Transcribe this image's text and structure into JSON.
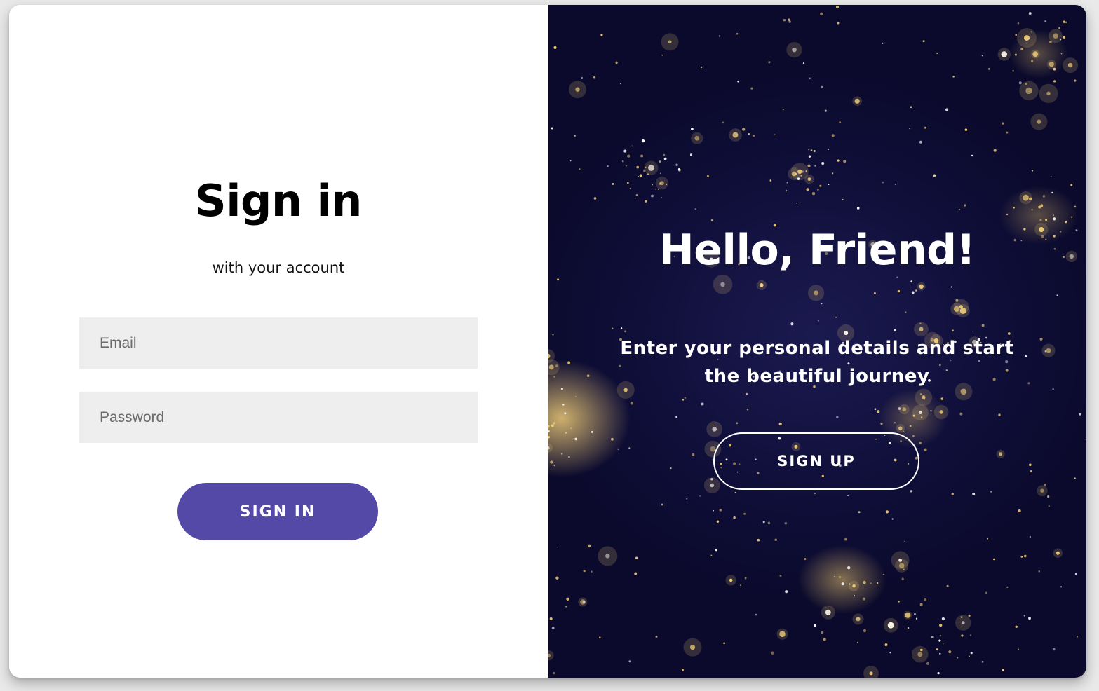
{
  "sign_in_panel": {
    "title": "Sign in",
    "subtitle": "with your account",
    "email_placeholder": "Email",
    "password_placeholder": "Password",
    "submit_label": "SIGN IN"
  },
  "sign_up_panel": {
    "heading": "Hello, Friend!",
    "tagline": "Enter your personal details and start the beautiful journey",
    "button_label": "SIGN UP",
    "background_image": "night-city-lights"
  },
  "colors": {
    "primary_button": "#5549a8",
    "panel_background": "#0e0d36",
    "field_background": "#eeeeee",
    "lights": "#f0cd78"
  }
}
